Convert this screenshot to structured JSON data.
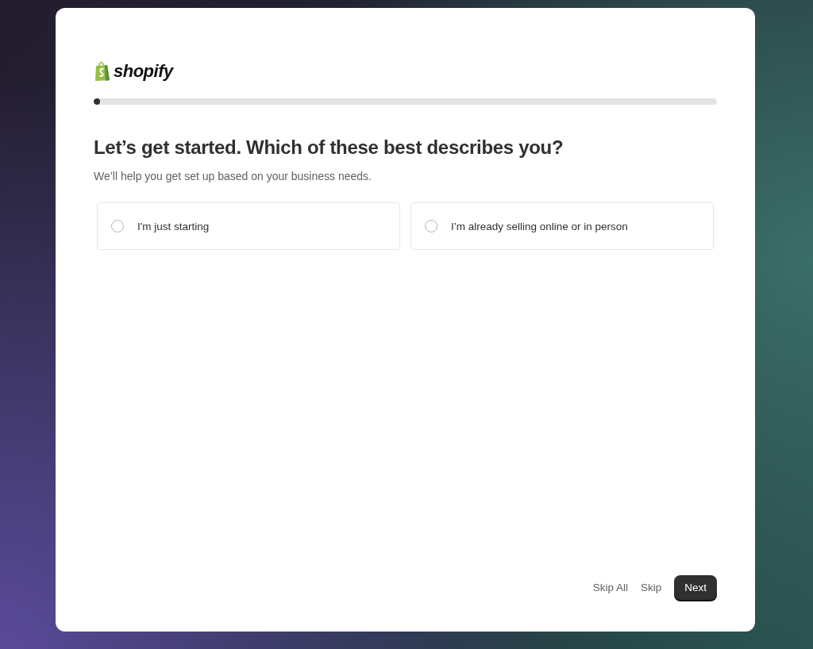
{
  "logo": {
    "wordmark": "shopify"
  },
  "progress": {
    "level": 0.01
  },
  "heading": "Let’s get started. Which of these best describes you?",
  "subtitle": "We’ll help you get set up based on your business needs.",
  "options": [
    {
      "label": "I'm just starting",
      "selected": false
    },
    {
      "label": "I’m already selling online or in person",
      "selected": false
    }
  ],
  "footer": {
    "skip_all": "Skip All",
    "skip": "Skip",
    "next": "Next"
  }
}
